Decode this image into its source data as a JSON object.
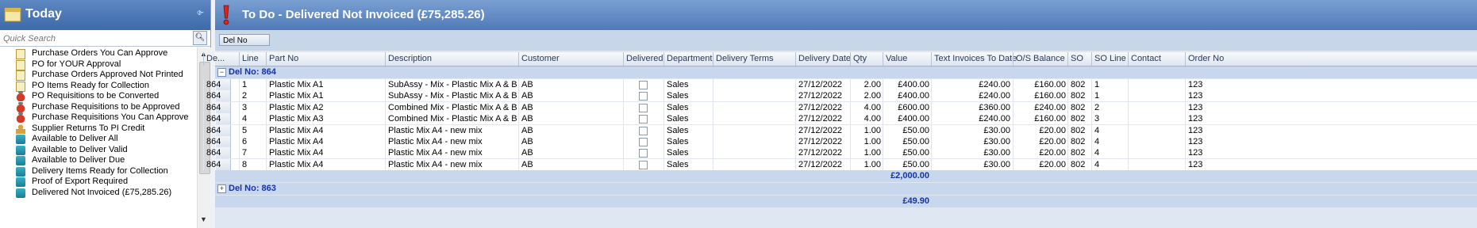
{
  "left_panel": {
    "title": "Today",
    "search_placeholder": "Quick Search",
    "items": [
      {
        "label": "Purchase Orders You Can Approve",
        "icon": "doc-icon"
      },
      {
        "label": "PO for YOUR Approval",
        "icon": "doc-icon"
      },
      {
        "label": "Purchase Orders Approved Not Printed",
        "icon": "doc-icon"
      },
      {
        "label": "PO Items Ready for Collection",
        "icon": "doc-icon"
      },
      {
        "label": "PO Requisitions to be Converted",
        "icon": "basket-icon"
      },
      {
        "label": "Purchase Requisitions to be Approved",
        "icon": "basket-icon"
      },
      {
        "label": "Purchase Requisitions You Can Approve",
        "icon": "basket-icon"
      },
      {
        "label": "Supplier Returns To PI Credit",
        "icon": "person-icon"
      },
      {
        "label": "Available to Deliver All",
        "icon": "truck-icon"
      },
      {
        "label": "Available to Deliver Valid",
        "icon": "truck-icon"
      },
      {
        "label": "Available to Deliver Due",
        "icon": "truck-icon"
      },
      {
        "label": "Delivery Items Ready for Collection",
        "icon": "truck-icon"
      },
      {
        "label": "Proof of Export Required",
        "icon": "truck-icon"
      },
      {
        "label": "Delivered Not Invoiced (£75,285.26)",
        "icon": "truck-icon"
      }
    ]
  },
  "main": {
    "title": "To Do  -  Delivered Not Invoiced (£75,285.26)",
    "group_by": "Del No",
    "columns": [
      "De...",
      "Line",
      "Part No",
      "Description",
      "Customer",
      "Delivered",
      "Department",
      "Delivery Terms",
      "Delivery Date",
      "Qty",
      "Value",
      "Text Invoices To Date",
      "O/S Balance",
      "SO",
      "SO Line",
      "Contact",
      "Order No"
    ],
    "groups": [
      {
        "label": "Del No:  864",
        "rows": [
          {
            "del": "864",
            "line": "1",
            "part": "Plastic Mix A1",
            "desc": "SubAssy - Mix - Plastic Mix A & B",
            "cust": "AB",
            "dept": "Sales",
            "date": "27/12/2022",
            "qty": "2.00",
            "value": "£400.00",
            "inv": "£240.00",
            "os": "£160.00",
            "so": "802",
            "soline": "1",
            "order": "123"
          },
          {
            "del": "864",
            "line": "2",
            "part": "Plastic Mix A1",
            "desc": "SubAssy - Mix - Plastic Mix A & B",
            "cust": "AB",
            "dept": "Sales",
            "date": "27/12/2022",
            "qty": "2.00",
            "value": "£400.00",
            "inv": "£240.00",
            "os": "£160.00",
            "so": "802",
            "soline": "1",
            "order": "123"
          },
          {
            "del": "864",
            "line": "3",
            "part": "Plastic Mix A2",
            "desc": "Combined Mix - Plastic Mix A & B - No ...",
            "cust": "AB",
            "dept": "Sales",
            "date": "27/12/2022",
            "qty": "4.00",
            "value": "£600.00",
            "inv": "£360.00",
            "os": "£240.00",
            "so": "802",
            "soline": "2",
            "order": "123"
          },
          {
            "del": "864",
            "line": "4",
            "part": "Plastic Mix A3",
            "desc": "Combined Mix - Plastic Mix A & B - No ...",
            "cust": "AB",
            "dept": "Sales",
            "date": "27/12/2022",
            "qty": "4.00",
            "value": "£400.00",
            "inv": "£240.00",
            "os": "£160.00",
            "so": "802",
            "soline": "3",
            "order": "123"
          },
          {
            "del": "864",
            "line": "5",
            "part": "Plastic Mix A4",
            "desc": "Plastic Mix A4 - new mix",
            "cust": "AB",
            "dept": "Sales",
            "date": "27/12/2022",
            "qty": "1.00",
            "value": "£50.00",
            "inv": "£30.00",
            "os": "£20.00",
            "so": "802",
            "soline": "4",
            "order": "123"
          },
          {
            "del": "864",
            "line": "6",
            "part": "Plastic Mix A4",
            "desc": "Plastic Mix A4 - new mix",
            "cust": "AB",
            "dept": "Sales",
            "date": "27/12/2022",
            "qty": "1.00",
            "value": "£50.00",
            "inv": "£30.00",
            "os": "£20.00",
            "so": "802",
            "soline": "4",
            "order": "123"
          },
          {
            "del": "864",
            "line": "7",
            "part": "Plastic Mix A4",
            "desc": "Plastic Mix A4 - new mix",
            "cust": "AB",
            "dept": "Sales",
            "date": "27/12/2022",
            "qty": "1.00",
            "value": "£50.00",
            "inv": "£30.00",
            "os": "£20.00",
            "so": "802",
            "soline": "4",
            "order": "123"
          },
          {
            "del": "864",
            "line": "8",
            "part": "Plastic Mix A4",
            "desc": "Plastic Mix A4 - new mix",
            "cust": "AB",
            "dept": "Sales",
            "date": "27/12/2022",
            "qty": "1.00",
            "value": "£50.00",
            "inv": "£30.00",
            "os": "£20.00",
            "so": "802",
            "soline": "4",
            "order": "123"
          }
        ],
        "total": "£2,000.00"
      },
      {
        "label": "Del No:  863",
        "total": "£49.90"
      }
    ]
  },
  "colors": {
    "header_blue": "#5079b8",
    "group_text": "#1433a8"
  }
}
